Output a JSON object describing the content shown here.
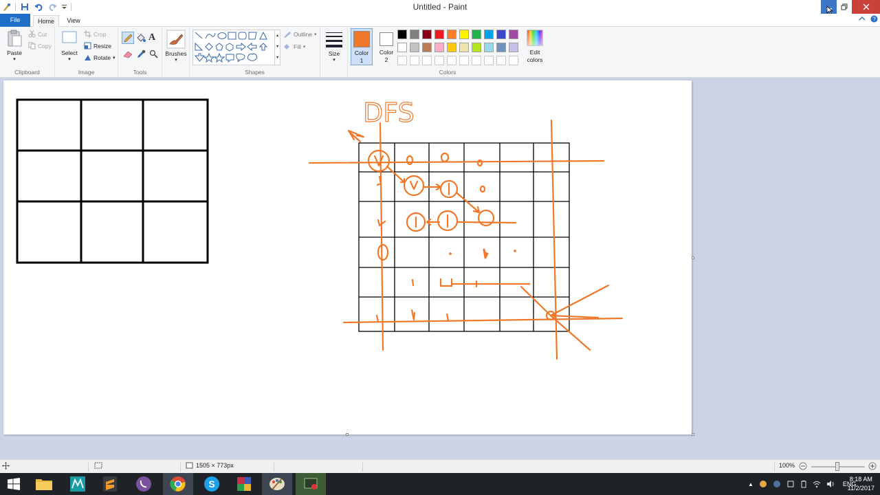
{
  "app": {
    "title": "Untitled - Paint"
  },
  "tabs": {
    "file": "File",
    "home": "Home",
    "view": "View"
  },
  "clipboard": {
    "paste": "Paste",
    "cut": "Cut",
    "copy": "Copy",
    "label": "Clipboard"
  },
  "image": {
    "select": "Select",
    "crop": "Crop",
    "resize": "Resize",
    "rotate": "Rotate",
    "label": "Image"
  },
  "tools": {
    "label": "Tools"
  },
  "brushes": {
    "label": "Brushes"
  },
  "shapes": {
    "outline": "Outline",
    "fill": "Fill",
    "label": "Shapes"
  },
  "size": {
    "label": "Size"
  },
  "colors": {
    "color1": "Color 1",
    "color2": "Color 2",
    "label": "Colors",
    "edit": "Edit colors",
    "color1_value": "#f0782a",
    "color2_value": "#ffffff",
    "palette_row1": [
      "#000000",
      "#7f7f7f",
      "#880015",
      "#ed1c24",
      "#ff7f27",
      "#fff200",
      "#22b14c",
      "#00a2e8",
      "#3f48cc",
      "#a349a4"
    ],
    "palette_row2": [
      "#ffffff",
      "#c3c3c3",
      "#b97a57",
      "#ffaec9",
      "#ffc90e",
      "#efe4b0",
      "#b5e61d",
      "#99d9ea",
      "#7092be",
      "#c8bfe7"
    ]
  },
  "canvas": {
    "drawing_text": "DFS",
    "accent": "#f0782a"
  },
  "status": {
    "dimensions": "1505 × 773px",
    "zoom": "100%"
  },
  "tray": {
    "lang": "ENG",
    "time": "8:18 AM",
    "date": "11/2/2017"
  }
}
